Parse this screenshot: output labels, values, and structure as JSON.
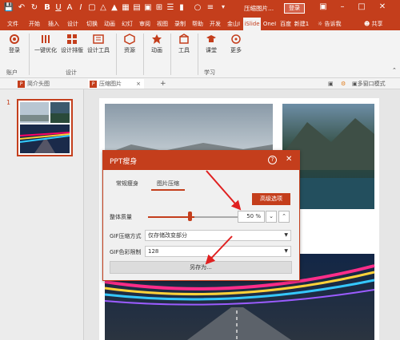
{
  "titlebar": {
    "quick_access": [
      "save-icon",
      "undo-icon",
      "redo-icon",
      "repeat-icon",
      "bold-icon",
      "underline-icon",
      "text-size-icon",
      "italic-icon",
      "shape-icon",
      "triangle-icon",
      "fill-icon",
      "grid-icon",
      "text-box-icon",
      "image-icon",
      "crop-icon",
      "align-icon",
      "line-icon",
      "circle-icon",
      "more-icon"
    ],
    "doc_title": "压缩图片...",
    "login_label": "登录",
    "bg_color": "#c43e1c"
  },
  "tabs": [
    {
      "label": "文件"
    },
    {
      "label": "开始"
    },
    {
      "label": "插入"
    },
    {
      "label": "设计"
    },
    {
      "label": "切换"
    },
    {
      "label": "动画"
    },
    {
      "label": "幻灯"
    },
    {
      "label": "审阅"
    },
    {
      "label": "视图"
    },
    {
      "label": "录制"
    },
    {
      "label": "帮助"
    },
    {
      "label": "开发"
    },
    {
      "label": "金山I"
    },
    {
      "label": "iSlide",
      "active": true
    },
    {
      "label": "OneI"
    },
    {
      "label": "百度"
    },
    {
      "label": "新建1"
    }
  ],
  "tell_me": "告诉我",
  "share": "共享",
  "ribbon": {
    "login": "登录",
    "account_group": "账户",
    "one_click": "一键优化",
    "design_layout": "设计排版",
    "design_tools": "设计工具",
    "design_group": "设计",
    "resources": "资源",
    "animation": "动画",
    "tools": "工具",
    "classroom": "课堂",
    "more": "更多",
    "learn_group": "学习"
  },
  "docbar": {
    "tab1": "简介头图",
    "tab2": "压缩图片",
    "plus": "+",
    "right_label": "多窗口模式"
  },
  "thumbs": {
    "slide_number": "1"
  },
  "dialog": {
    "title": "PPT瘦身",
    "tab_regular": "常规瘦身",
    "tab_image": "图片压缩",
    "advanced": "高级选项",
    "quality_label": "整体质量",
    "quality_value": "50 %",
    "quality_fraction": 0.5,
    "gif_mode_label": "GIF压缩方式",
    "gif_mode_value": "仅存储改变部分",
    "gif_color_label": "GIF色彩限制",
    "gif_color_value": "128",
    "save_as": "另存为..."
  },
  "colors": {
    "accent": "#c43e1c",
    "arrow": "#e02020"
  }
}
